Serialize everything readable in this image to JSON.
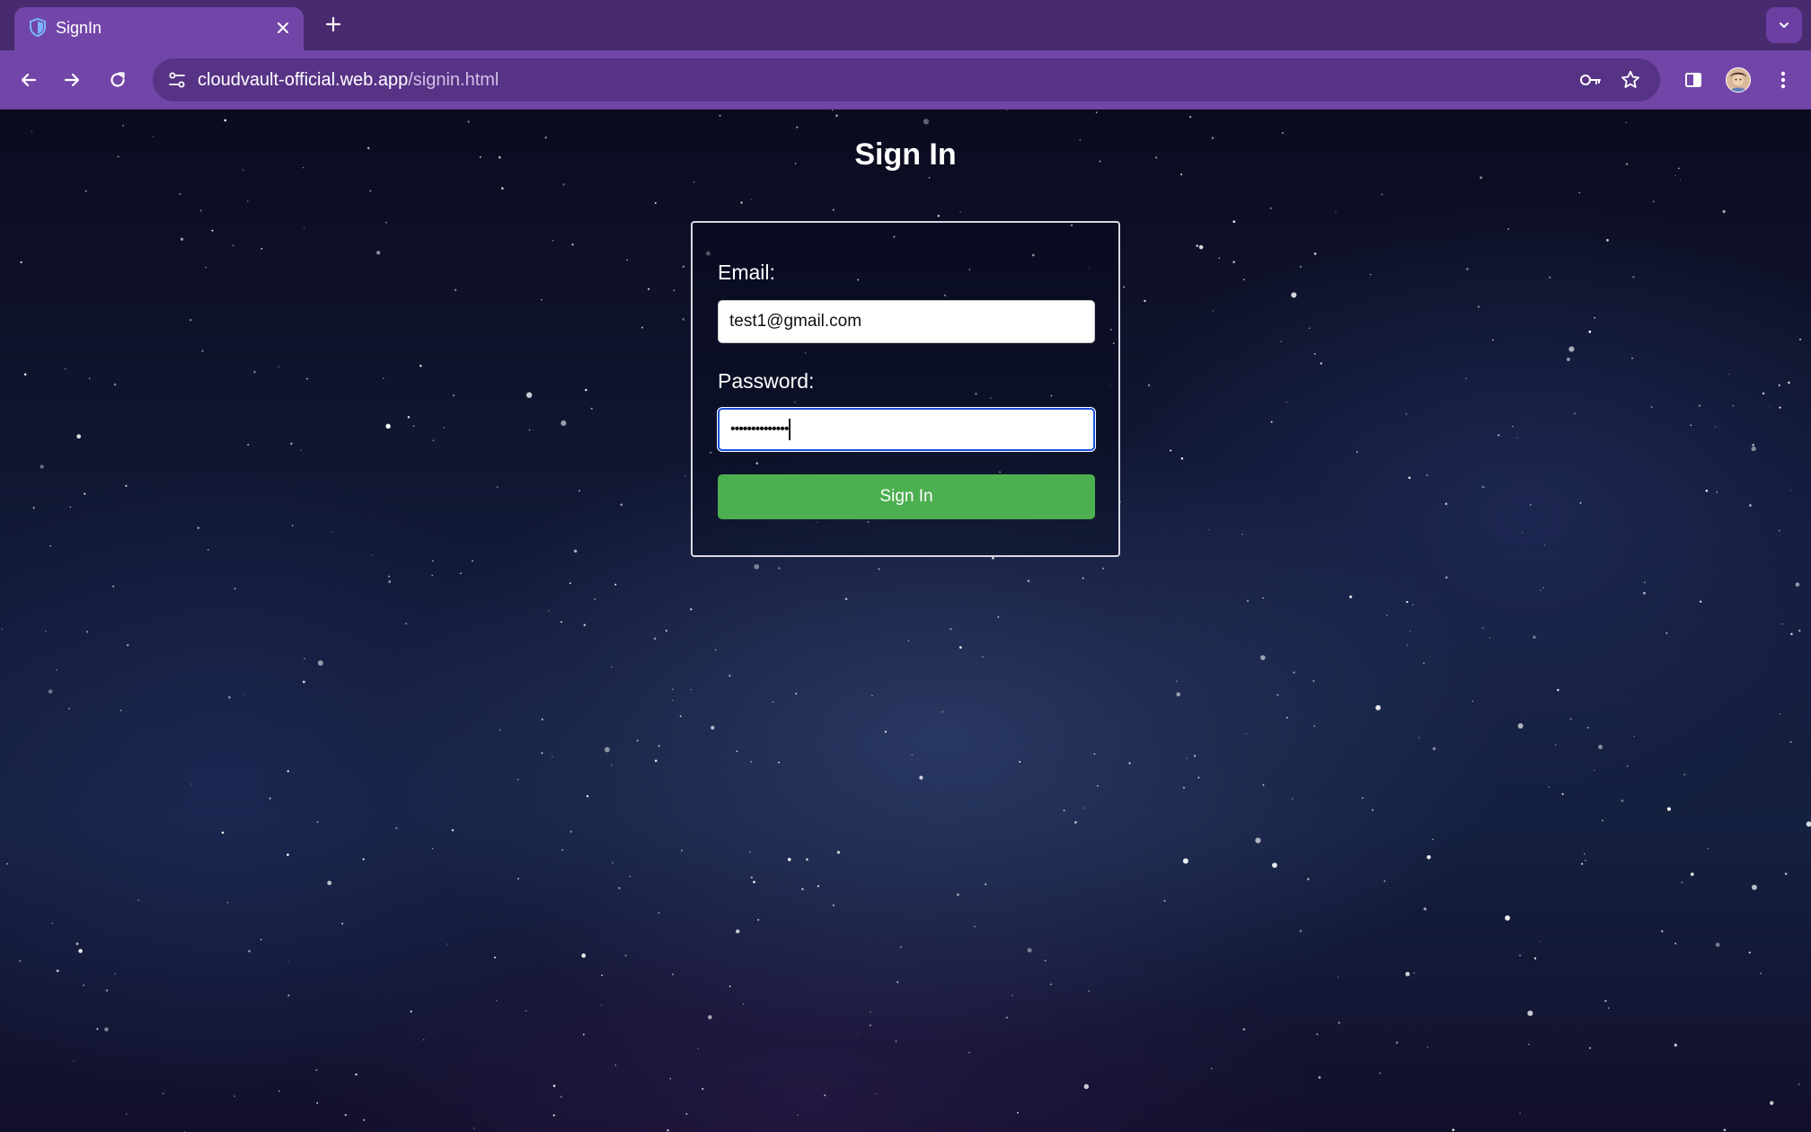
{
  "browser": {
    "tab": {
      "title": "SignIn",
      "favicon": "shield-icon"
    },
    "new_tab_icon": "plus-icon",
    "tab_search_icon": "chevron-down-icon",
    "toolbar": {
      "back_icon": "arrow-left-icon",
      "forward_icon": "arrow-right-icon",
      "reload_icon": "reload-icon",
      "site_info_icon": "tune-icon",
      "url_host": "cloudvault-official.web.app",
      "url_path": "/signin.html",
      "password_key_icon": "key-icon",
      "bookmark_icon": "star-icon",
      "side_panel_icon": "side-panel-icon",
      "profile_icon": "avatar",
      "menu_icon": "kebab-menu-icon"
    },
    "colors": {
      "tabstrip": "#482a6e",
      "toolbar": "#7246a8",
      "omnibox": "#573386"
    }
  },
  "page": {
    "title": "Sign In",
    "form": {
      "email_label": "Email:",
      "email_value": "test1@gmail.com",
      "password_label": "Password:",
      "password_value": "••••••••••••••",
      "submit_label": "Sign In"
    },
    "colors": {
      "button": "#4caf50",
      "focus_ring": "#1a4fd8"
    }
  }
}
